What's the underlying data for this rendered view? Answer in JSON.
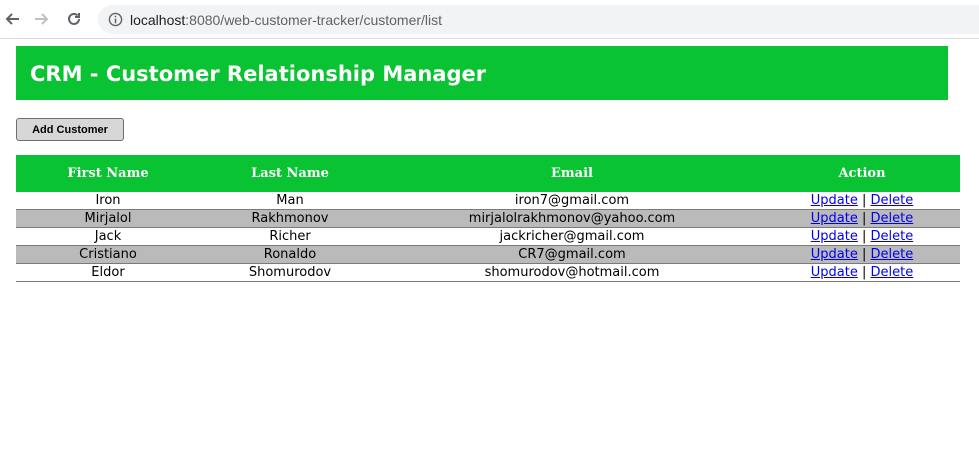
{
  "browser": {
    "url_host": "localhost",
    "url_rest": ":8080/web-customer-tracker/customer/list"
  },
  "header": {
    "title": "CRM - Customer Relationship Manager"
  },
  "toolbar": {
    "add_label": "Add Customer"
  },
  "table": {
    "columns": [
      "First Name",
      "Last Name",
      "Email",
      "Action"
    ],
    "rows": [
      {
        "first_name": "Iron",
        "last_name": "Man",
        "email": "iron7@gmail.com"
      },
      {
        "first_name": "Mirjalol",
        "last_name": "Rakhmonov",
        "email": "mirjalolrakhmonov@yahoo.com"
      },
      {
        "first_name": "Jack",
        "last_name": "Richer",
        "email": "jackricher@gmail.com"
      },
      {
        "first_name": "Cristiano",
        "last_name": "Ronaldo",
        "email": "CR7@gmail.com"
      },
      {
        "first_name": "Eldor",
        "last_name": "Shomurodov",
        "email": "shomurodov@hotmail.com"
      }
    ],
    "update_label": "Update",
    "delete_label": "Delete",
    "separator": "|"
  },
  "colors": {
    "header_green": "#09c332",
    "alt_row_gray": "#bababa",
    "link_blue": "#0000ee"
  }
}
